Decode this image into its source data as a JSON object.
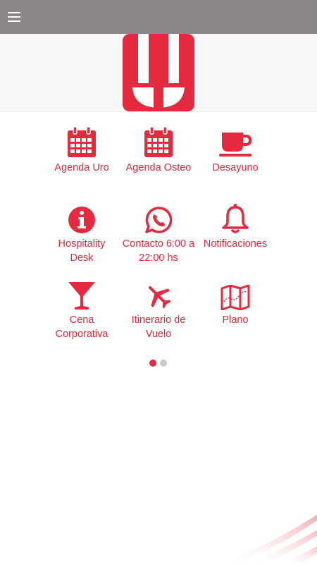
{
  "colors": {
    "accent": "#e5293e",
    "topbar": "#8a8685",
    "header_band": "#f7f7f7",
    "dot_inactive": "#c9c9c9"
  },
  "topbar": {
    "menu_icon": "hamburger-menu-icon"
  },
  "header": {
    "logo": "brand-logo"
  },
  "tiles": [
    {
      "label": "Agenda Uro",
      "icon": "calendar-icon"
    },
    {
      "label": "Agenda Osteo",
      "icon": "calendar-icon"
    },
    {
      "label": "Desayuno",
      "icon": "coffee-cup-icon"
    },
    {
      "label": "Hospitality\nDesk",
      "icon": "info-icon"
    },
    {
      "label": "Contacto 6:00 a\n22:00 hs",
      "icon": "whatsapp-icon"
    },
    {
      "label": "Notificaciones",
      "icon": "bell-icon"
    },
    {
      "label": "Cena\nCorporativa",
      "icon": "cocktail-glass-icon"
    },
    {
      "label": "Itinerario de\nVuelo",
      "icon": "airplane-icon"
    },
    {
      "label": "Plano",
      "icon": "map-icon"
    }
  ],
  "pager": {
    "pages": 2,
    "current": 1
  }
}
